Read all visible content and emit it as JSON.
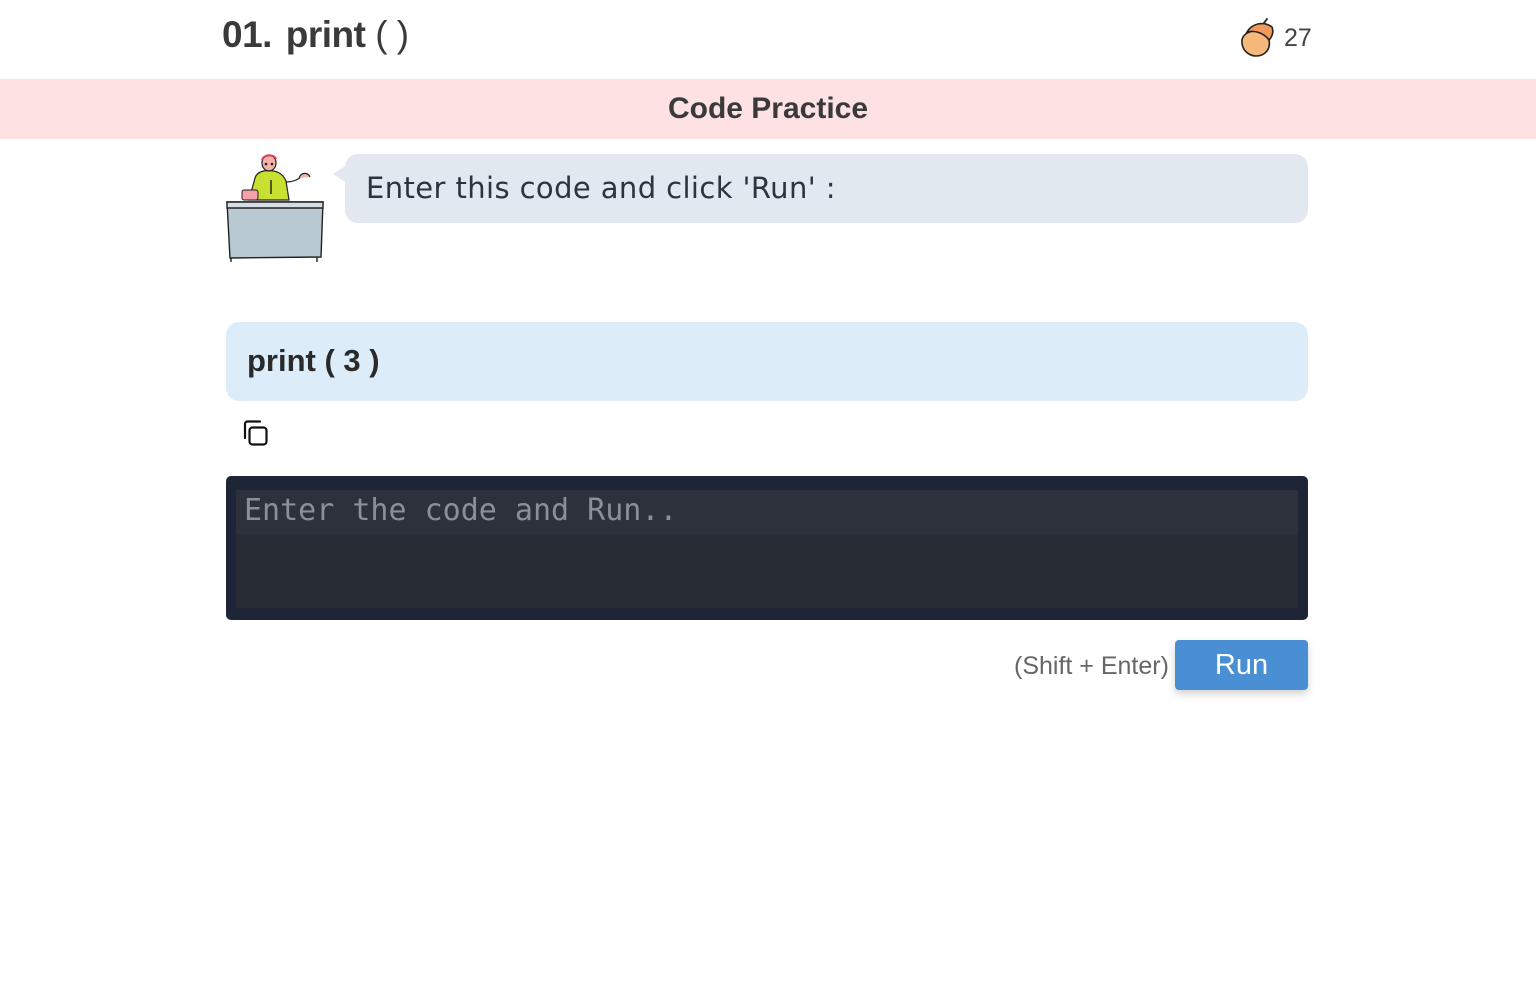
{
  "header": {
    "lesson_number": "01.",
    "lesson_name": "print",
    "lesson_parens": "( )",
    "acorn_count": "27",
    "acorn_icon": "acorn-icon"
  },
  "banner": {
    "title": "Code Practice"
  },
  "instruction": {
    "text": "Enter this code and click 'Run' :",
    "mascot": "teacher-at-desk"
  },
  "example": {
    "code": "print ( 3 )",
    "copy_icon": "copy-icon"
  },
  "editor": {
    "placeholder": "Enter the code and Run..",
    "value": ""
  },
  "actions": {
    "shortcut_hint": "(Shift + Enter)",
    "run_label": "Run"
  },
  "colors": {
    "banner_bg": "#fde1e3",
    "bubble_bg": "#e2e8f0",
    "example_bg": "#dcedf9",
    "editor_bg": "#1e2537",
    "run_button": "#4a8fd4",
    "acorn": "#f6b97a"
  }
}
